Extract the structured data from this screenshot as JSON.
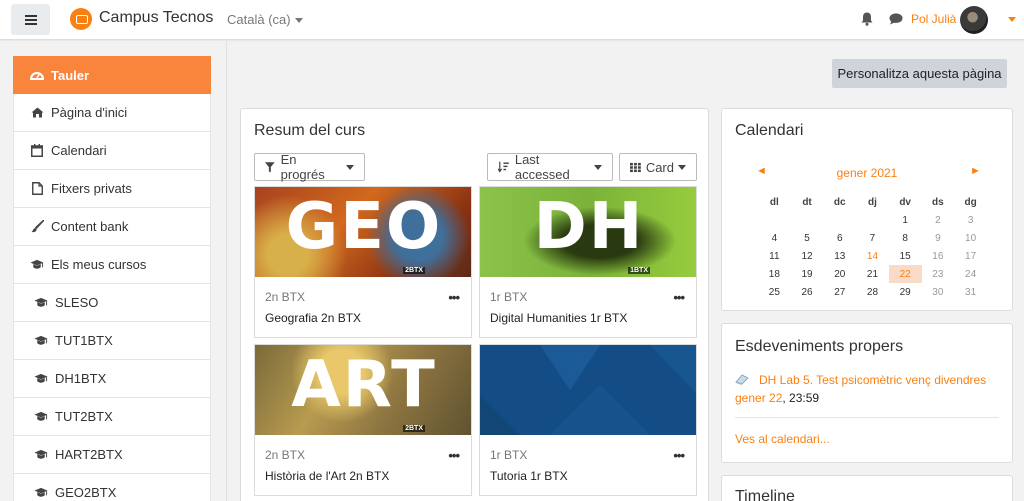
{
  "header": {
    "site_name": "Campus Tecnos",
    "language": "Català (ca)",
    "user_name": "Pol Julià",
    "accent_color": "#f98012",
    "icons": [
      "menu-icon",
      "bell-icon",
      "chat-icon"
    ]
  },
  "sidebar": {
    "items": [
      {
        "label": "Tauler",
        "icon": "dashboard-icon"
      },
      {
        "label": "Pàgina d'inici",
        "icon": "home-icon"
      },
      {
        "label": "Calendari",
        "icon": "calendar-icon"
      },
      {
        "label": "Fitxers privats",
        "icon": "file-icon"
      },
      {
        "label": "Content bank",
        "icon": "brush-icon"
      },
      {
        "label": "Els meus cursos",
        "icon": "graduation-cap-icon"
      },
      {
        "label": "SLESO",
        "icon": "graduation-cap-icon"
      },
      {
        "label": "TUT1BTX",
        "icon": "graduation-cap-icon"
      },
      {
        "label": "DH1BTX",
        "icon": "graduation-cap-icon"
      },
      {
        "label": "TUT2BTX",
        "icon": "graduation-cap-icon"
      },
      {
        "label": "HART2BTX",
        "icon": "graduation-cap-icon"
      },
      {
        "label": "GEO2BTX",
        "icon": "graduation-cap-icon"
      }
    ]
  },
  "main": {
    "customize_label": "Personalitza aquesta pàgina",
    "course_overview": {
      "title": "Resum del curs",
      "filter_label": "En progrés",
      "sort_label": "Last accessed",
      "view_label": "Card",
      "more_glyph": "•••",
      "courses": [
        {
          "image_text": "GEO",
          "image_tag": "2BTX",
          "category": "2n BTX",
          "name": "Geografia 2n BTX"
        },
        {
          "image_text": "DH",
          "image_tag": "1BTX",
          "category": "1r BTX",
          "name": "Digital Humanities 1r BTX"
        },
        {
          "image_text": "ART",
          "image_tag": "2BTX",
          "category": "2n BTX",
          "name": "Història de l'Art 2n BTX"
        },
        {
          "image_text": "",
          "image_tag": "",
          "category": "1r BTX",
          "name": "Tutoria 1r BTX"
        }
      ]
    }
  },
  "calendar": {
    "title": "Calendari",
    "prev": "◄",
    "next": "►",
    "month": "gener 2021",
    "weekdays": [
      "dl",
      "dt",
      "dc",
      "dj",
      "dv",
      "ds",
      "dg"
    ],
    "weeks": [
      [
        "",
        "",
        "",
        "",
        "1",
        "2",
        "3"
      ],
      [
        "4",
        "5",
        "6",
        "7",
        "8",
        "9",
        "10"
      ],
      [
        "11",
        "12",
        "13",
        "14",
        "15",
        "16",
        "17"
      ],
      [
        "18",
        "19",
        "20",
        "21",
        "22",
        "23",
        "24"
      ],
      [
        "25",
        "26",
        "27",
        "28",
        "29",
        "30",
        "31"
      ]
    ],
    "event_day": "14",
    "today": "22"
  },
  "upcoming": {
    "title": "Esdeveniments propers",
    "event_title": "DH Lab 5. Test psicomètric",
    "event_date": "venç divendres gener 22",
    "event_time": ", 23:59",
    "more_link": "Ves al calendari..."
  },
  "timeline": {
    "title": "Timeline"
  }
}
